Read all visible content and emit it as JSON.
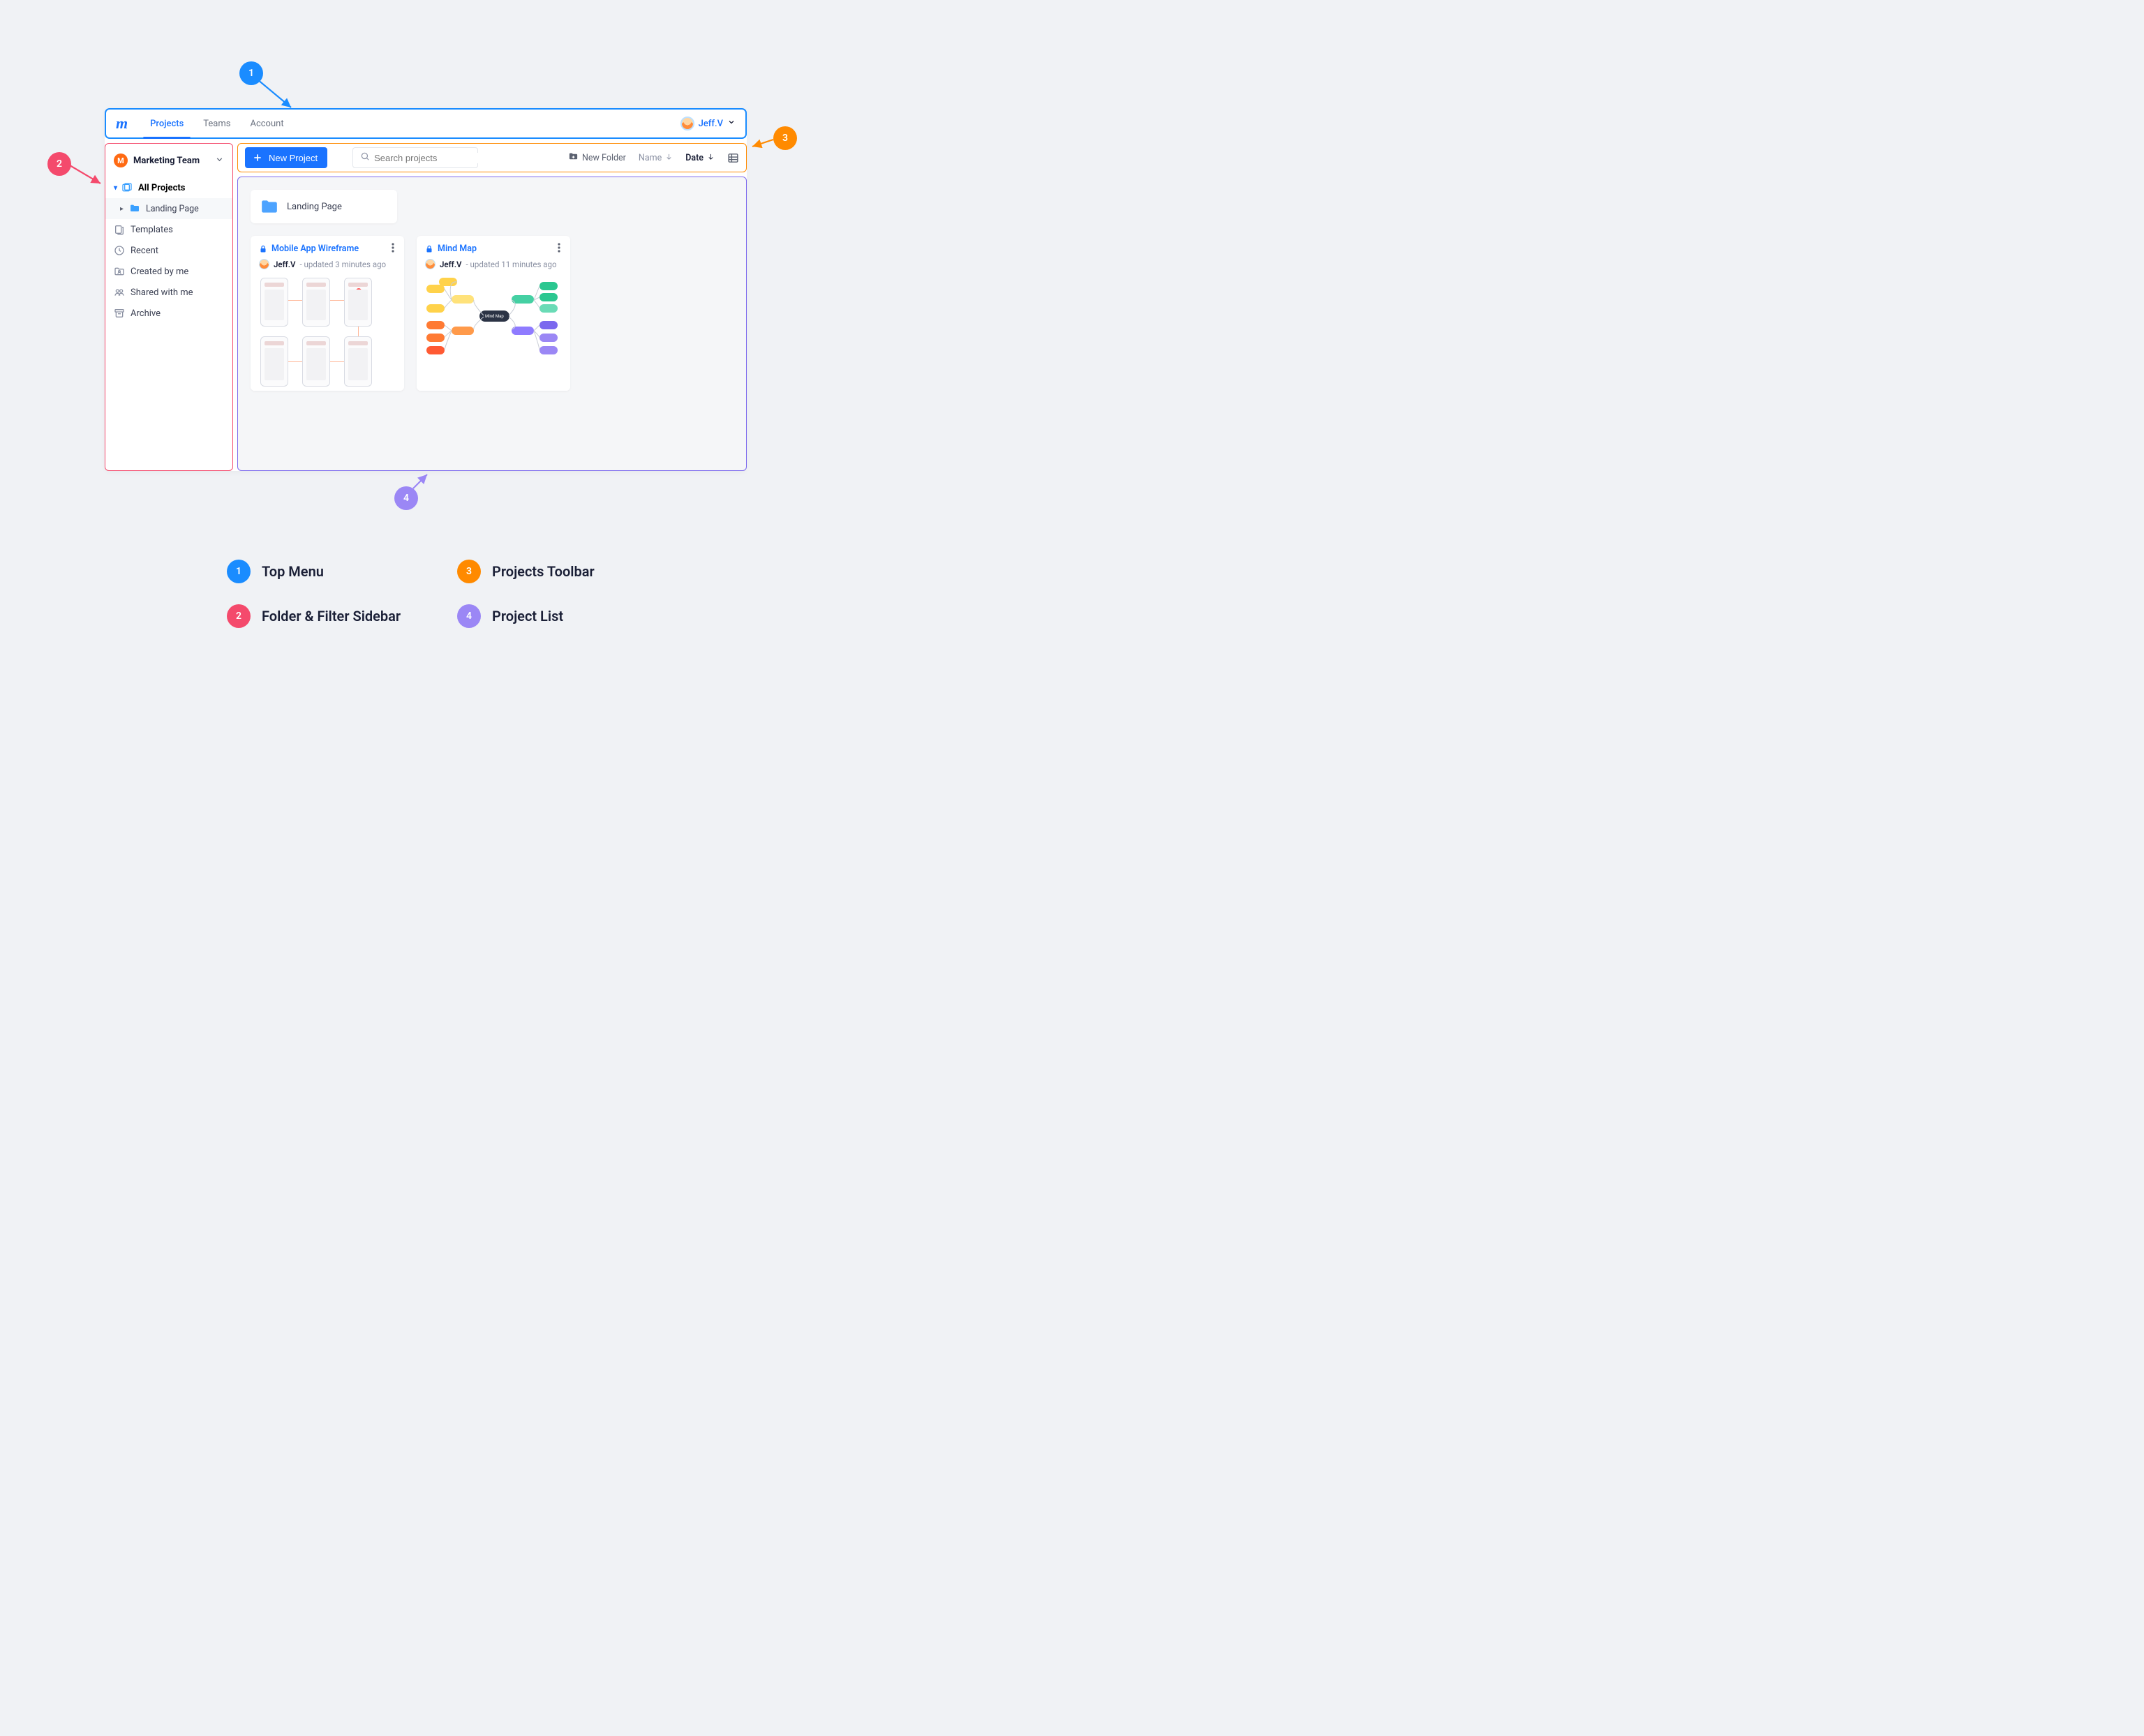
{
  "callouts": {
    "n1": "1",
    "n2": "2",
    "n3": "3",
    "n4": "4",
    "legend1": "Top Menu",
    "legend2": "Folder & Filter Sidebar",
    "legend3": "Projects Toolbar",
    "legend4": "Project List"
  },
  "topmenu": {
    "logo": "m",
    "tabs": {
      "projects": "Projects",
      "teams": "Teams",
      "account": "Account"
    },
    "user": "Jeff.V"
  },
  "sidebar": {
    "team_initial": "M",
    "team_name": "Marketing Team",
    "all_projects": "All Projects",
    "landing_page": "Landing Page",
    "templates": "Templates",
    "recent": "Recent",
    "created_by_me": "Created by me",
    "shared_with_me": "Shared with me",
    "archive": "Archive"
  },
  "toolbar": {
    "new_project": "New Project",
    "search_placeholder": "Search projects",
    "new_folder": "New Folder",
    "sort_name": "Name",
    "sort_date": "Date"
  },
  "folder": {
    "name": "Landing Page"
  },
  "cards": {
    "c1": {
      "title": "Mobile App Wireframe",
      "author": "Jeff.V",
      "meta": " - updated  3  minutes ago"
    },
    "c2": {
      "title": "Mind Map",
      "author": "Jeff.V",
      "meta": " - updated 11 minutes ago"
    }
  }
}
